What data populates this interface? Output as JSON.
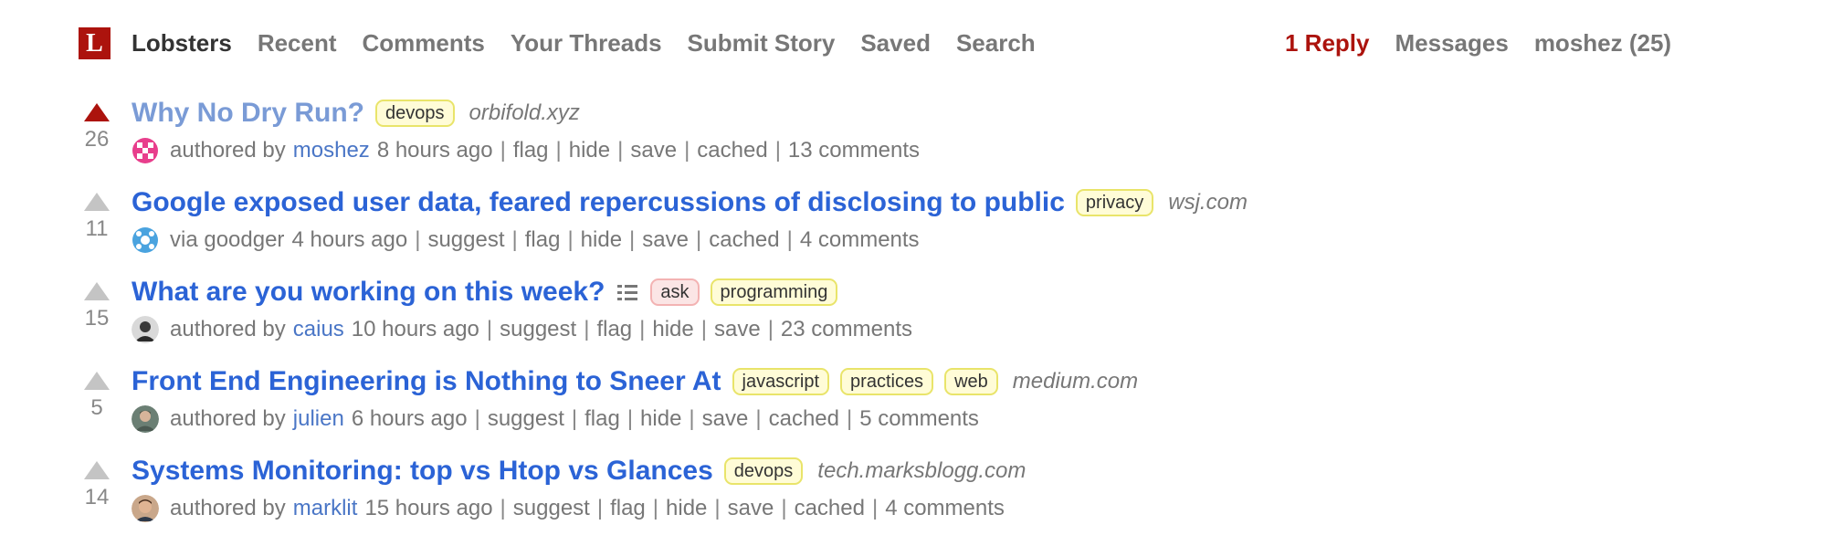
{
  "header": {
    "logo_letter": "L",
    "nav": [
      "Lobsters",
      "Recent",
      "Comments",
      "Your Threads",
      "Submit Story",
      "Saved",
      "Search"
    ],
    "reply": "1 Reply",
    "messages": "Messages",
    "user": "moshez (25)"
  },
  "colors": {
    "brand": "#ac130d",
    "link": "#2b63d6",
    "visited": "#7a9bd6"
  },
  "stories": [
    {
      "title": "Why No Dry Run?",
      "tags": [
        "devops"
      ],
      "domain": "orbifold.xyz",
      "score": "26",
      "voted": true,
      "visited": true,
      "byline_prefix": "authored by",
      "user": "moshez",
      "time": "8 hours ago",
      "actions": [
        "flag",
        "hide",
        "save",
        "cached",
        "13 comments"
      ],
      "avatar_icon": "pink-pattern-avatar"
    },
    {
      "title": "Google exposed user data, feared repercussions of disclosing to public",
      "tags": [
        "privacy"
      ],
      "domain": "wsj.com",
      "score": "11",
      "voted": false,
      "visited": false,
      "byline_prefix": "via goodger",
      "user": "",
      "time": "4 hours ago",
      "actions": [
        "suggest",
        "flag",
        "hide",
        "save",
        "cached",
        "4 comments"
      ],
      "avatar_icon": "blue-pattern-avatar"
    },
    {
      "title": "What are you working on this week?",
      "tags": [
        "ask",
        "programming"
      ],
      "domain": "",
      "score": "15",
      "voted": false,
      "visited": false,
      "byline_prefix": "authored by",
      "user": "caius",
      "time": "10 hours ago",
      "actions": [
        "suggest",
        "flag",
        "hide",
        "save",
        "23 comments"
      ],
      "avatar_icon": "photo-avatar"
    },
    {
      "title": "Front End Engineering is Nothing to Sneer At",
      "tags": [
        "javascript",
        "practices",
        "web"
      ],
      "domain": "medium.com",
      "score": "5",
      "voted": false,
      "visited": false,
      "byline_prefix": "authored by",
      "user": "julien",
      "time": "6 hours ago",
      "actions": [
        "suggest",
        "flag",
        "hide",
        "save",
        "cached",
        "5 comments"
      ],
      "avatar_icon": "photo-avatar"
    },
    {
      "title": "Systems Monitoring: top vs Htop vs Glances",
      "tags": [
        "devops"
      ],
      "domain": "tech.marksblogg.com",
      "score": "14",
      "voted": false,
      "visited": false,
      "byline_prefix": "authored by",
      "user": "marklit",
      "time": "15 hours ago",
      "actions": [
        "suggest",
        "flag",
        "hide",
        "save",
        "cached",
        "4 comments"
      ],
      "avatar_icon": "photo-avatar"
    }
  ]
}
